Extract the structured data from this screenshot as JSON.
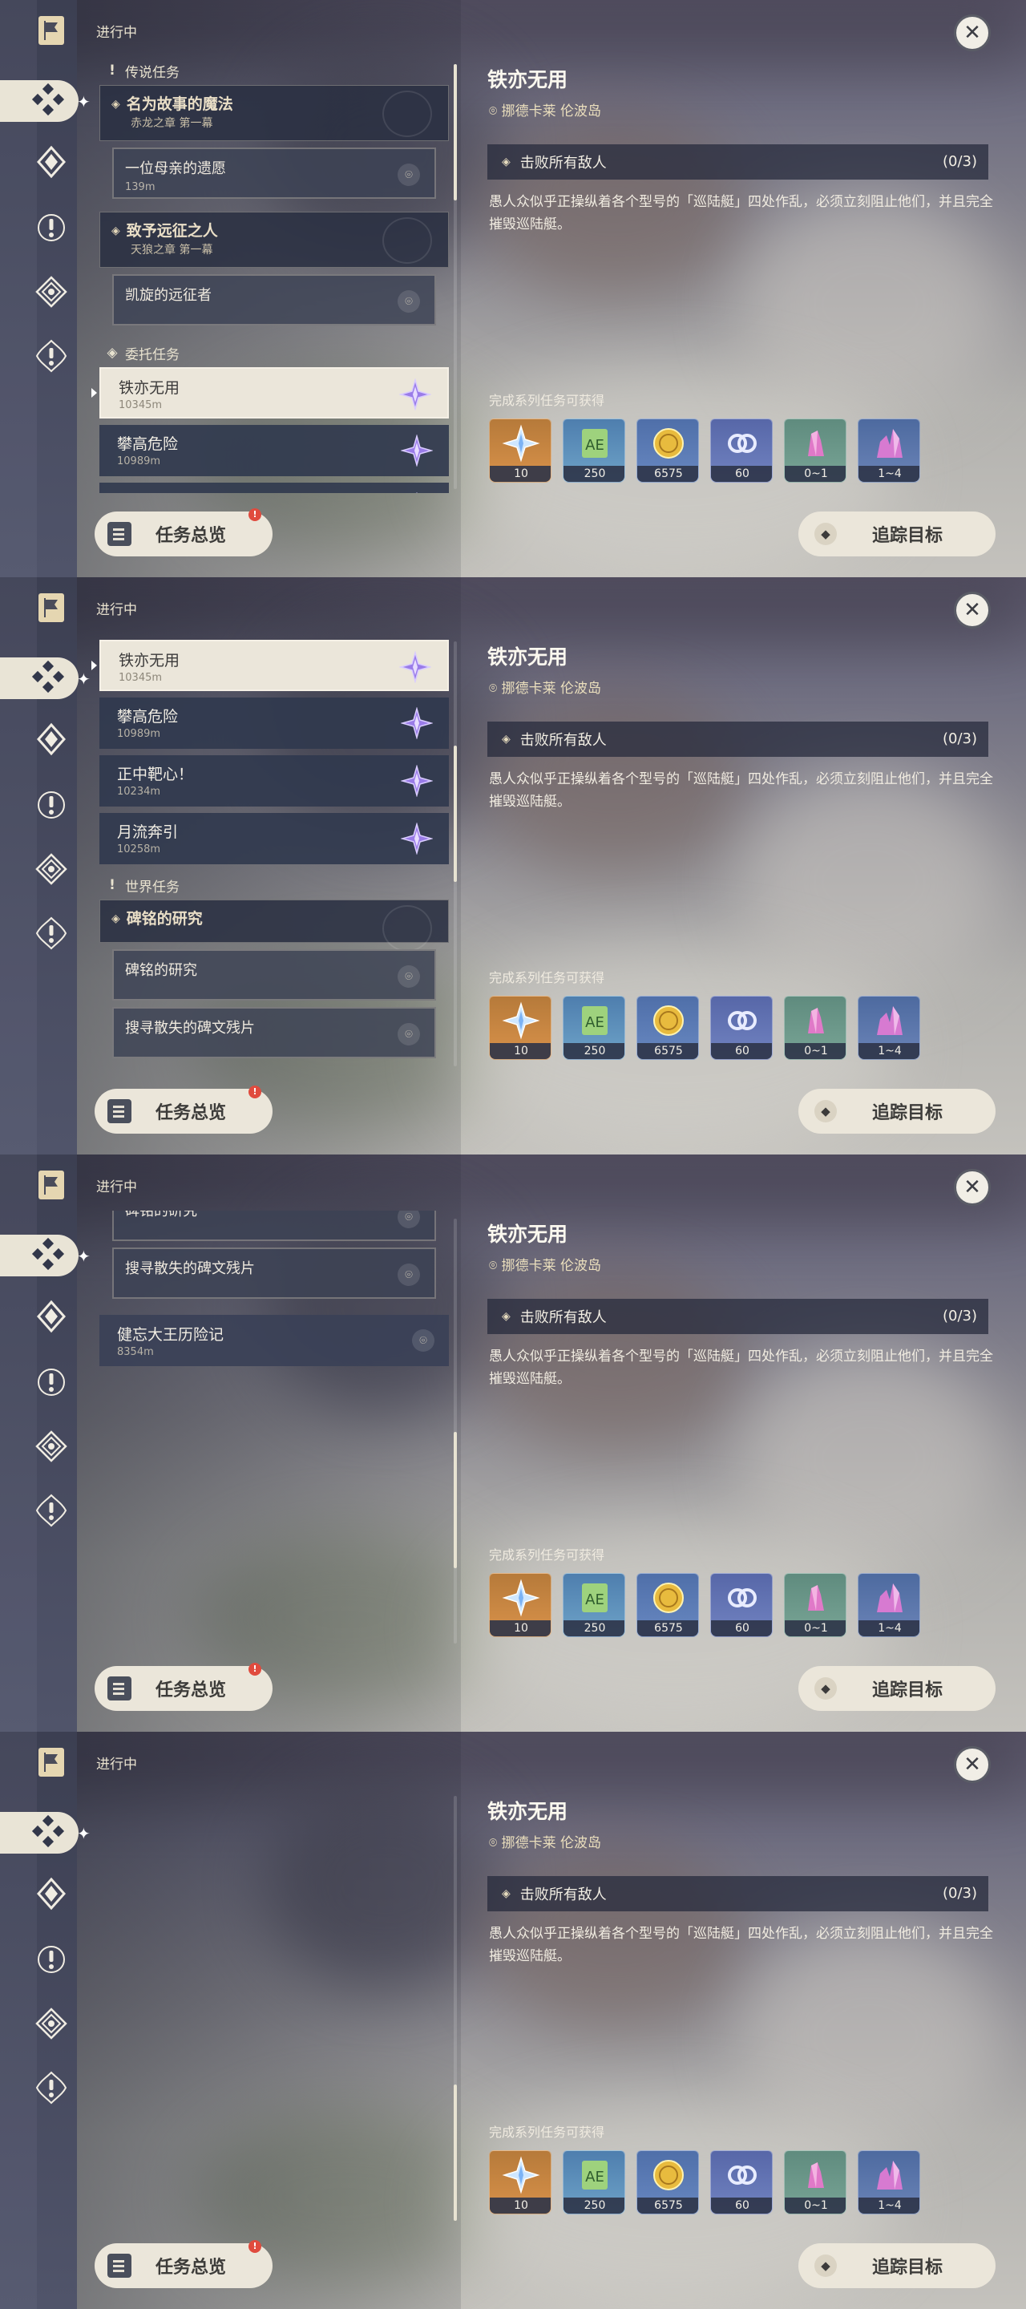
{
  "header": {
    "status_label": "进行中"
  },
  "sidebar": {
    "icons": [
      "quest-flag-icon",
      "quest-diamond-icon",
      "legend-quest-icon",
      "exclamation-icon",
      "commission-icon",
      "world-quest-icon"
    ]
  },
  "sections": {
    "legend": "传说任务",
    "commission": "委托任务",
    "world": "世界任务"
  },
  "legend_quests": [
    {
      "title": "名为故事的魔法",
      "subtitle": "赤龙之章 第一幕",
      "step": "一位母亲的遗愿",
      "distance": "139m"
    },
    {
      "title": "致予远征之人",
      "subtitle": "天狼之章 第一幕",
      "step": "凯旋的远征者"
    }
  ],
  "commissions": [
    {
      "title": "铁亦无用",
      "distance": "10345m"
    },
    {
      "title": "攀高危险",
      "distance": "10989m"
    },
    {
      "title": "正中靶心！",
      "distance": "10234m"
    },
    {
      "title": "月流奔引",
      "distance": "10258m"
    }
  ],
  "world_quests": [
    {
      "title": "碑铭的研究",
      "steps": [
        "碑铭的研究",
        "搜寻散失的碑文残片"
      ]
    }
  ],
  "other_quests": [
    {
      "title": "健忘大王历险记",
      "distance": "8354m"
    }
  ],
  "detail": {
    "title": "铁亦无用",
    "location": "挪德卡莱 伦波岛",
    "objective": "击败所有敌人",
    "progress": "(0/3)",
    "description": "愚人众似乎正操纵着各个型号的「巡陆艇」四处作乱，必须立刻阻止他们，并且完全摧毁巡陆艇。",
    "rewards_title": "完成系列任务可获得",
    "rewards": [
      {
        "icon": "primogem-icon",
        "count": "10"
      },
      {
        "icon": "adventure-exp-icon",
        "count": "250"
      },
      {
        "icon": "mora-icon",
        "count": "6575"
      },
      {
        "icon": "friendship-exp-icon",
        "count": "60"
      },
      {
        "icon": "crystal-fragment-icon",
        "count": "0~1"
      },
      {
        "icon": "crystal-chunk-icon",
        "count": "1~4"
      }
    ]
  },
  "buttons": {
    "overview": "任务总览",
    "overview_badge": "!",
    "track": "追踪目标",
    "close": "✕"
  },
  "scroll_states": [
    0.0,
    0.36,
    0.74,
    1.0
  ]
}
